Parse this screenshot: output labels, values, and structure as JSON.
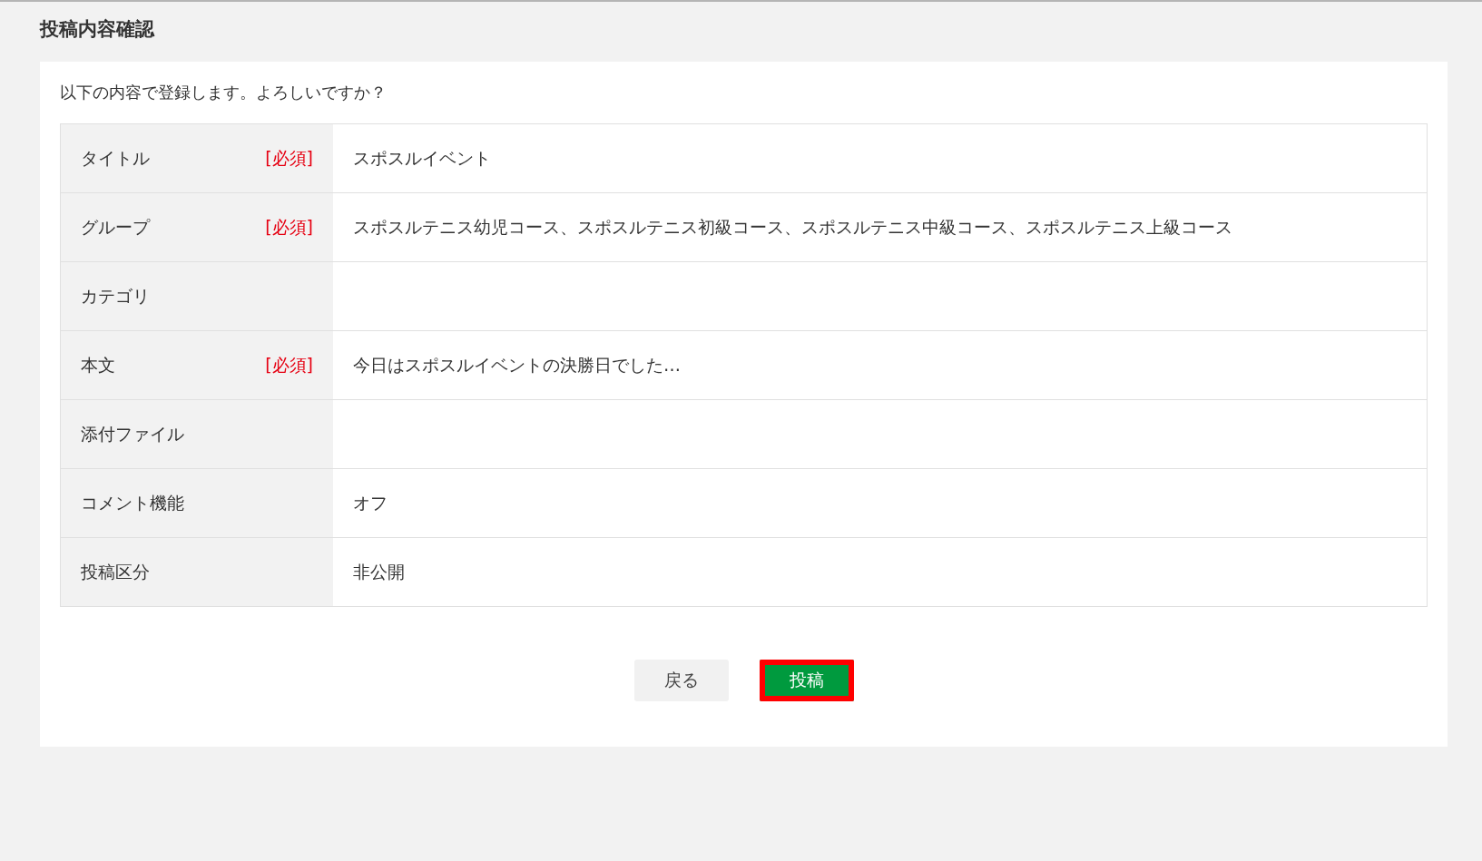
{
  "page_title": "投稿内容確認",
  "intro": "以下の内容で登録します。よろしいですか？",
  "rows": [
    {
      "label": "タイトル",
      "required_tag": "[必須]",
      "value": "スポスルイベント"
    },
    {
      "label": "グループ",
      "required_tag": "[必須]",
      "value": "スポスルテニス幼児コース、スポスルテニス初級コース、スポスルテニス中級コース、スポスルテニス上級コース"
    },
    {
      "label": "カテゴリ"
    },
    {
      "label": "本文",
      "required_tag": "[必須]",
      "value": "今日はスポスルイベントの決勝日でした…"
    },
    {
      "label": "添付ファイル"
    },
    {
      "label": "コメント機能",
      "value": "オフ"
    },
    {
      "label": "投稿区分",
      "value": "非公開"
    }
  ],
  "buttons": [
    {
      "label": "戻る",
      "kind": "secondary",
      "highlighted": false
    },
    {
      "label": "投稿",
      "kind": "primary",
      "highlighted": true
    }
  ]
}
